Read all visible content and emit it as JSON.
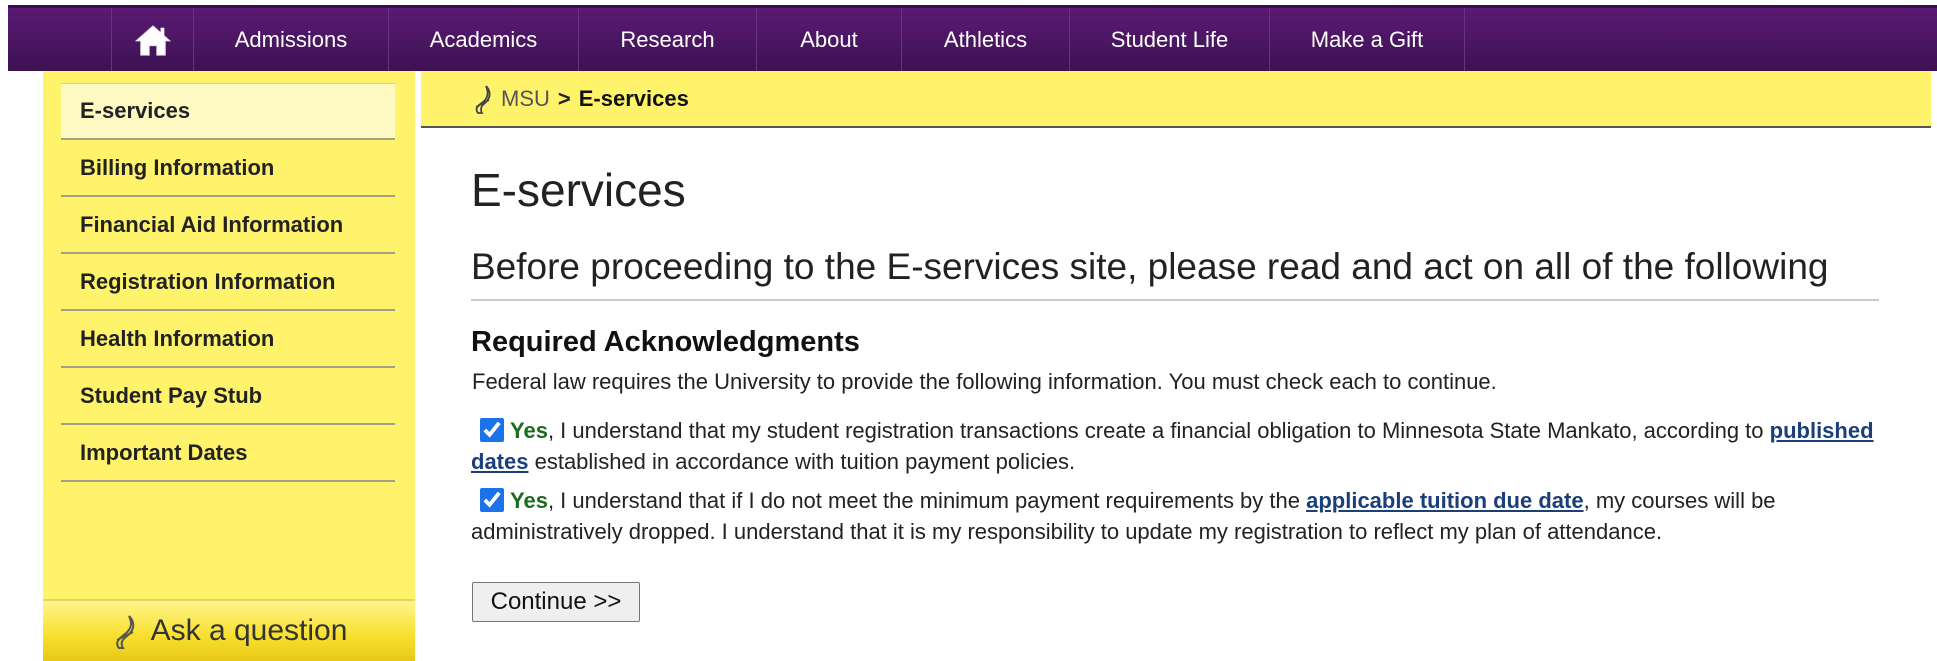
{
  "nav": {
    "home_label": "Home",
    "items": [
      "Admissions",
      "Academics",
      "Research",
      "About",
      "Athletics",
      "Student Life",
      "Make a Gift"
    ]
  },
  "sidebar": {
    "items": [
      {
        "label": "E-services",
        "active": true
      },
      {
        "label": "Billing Information"
      },
      {
        "label": "Financial Aid Information"
      },
      {
        "label": "Registration Information"
      },
      {
        "label": "Health Information"
      },
      {
        "label": "Student Pay Stub"
      },
      {
        "label": "Important Dates"
      }
    ],
    "ask_label": "Ask a question"
  },
  "breadcrumb": {
    "root": "MSU",
    "separator": ">",
    "current": "E-services"
  },
  "main": {
    "title": "E-services",
    "subtitle": "Before proceeding to the E-services site, please read and act on all of the following",
    "section_heading": "Required Acknowledgments",
    "intro": "Federal law requires the University to provide the following information. You must check each to continue.",
    "ack1": {
      "checked": true,
      "yes": "Yes",
      "text_before": ", I understand that my student registration transactions create a financial obligation to Minnesota State Mankato, according to ",
      "link": "published dates",
      "text_after": " established in accordance with tuition payment policies."
    },
    "ack2": {
      "checked": true,
      "yes": "Yes",
      "text_before": ", I understand that if I do not meet the minimum payment requirements by the ",
      "link": "applicable tuition due date",
      "text_after": ", my courses will be administratively dropped. I understand that it is my responsibility to update my registration to reflect my plan of attendance."
    },
    "continue_label": "Continue >>"
  },
  "colors": {
    "nav_purple": "#4a1661",
    "sidebar_yellow": "#fff36b",
    "yes_green": "#1e6b1e",
    "link_blue": "#1a3f7a"
  }
}
